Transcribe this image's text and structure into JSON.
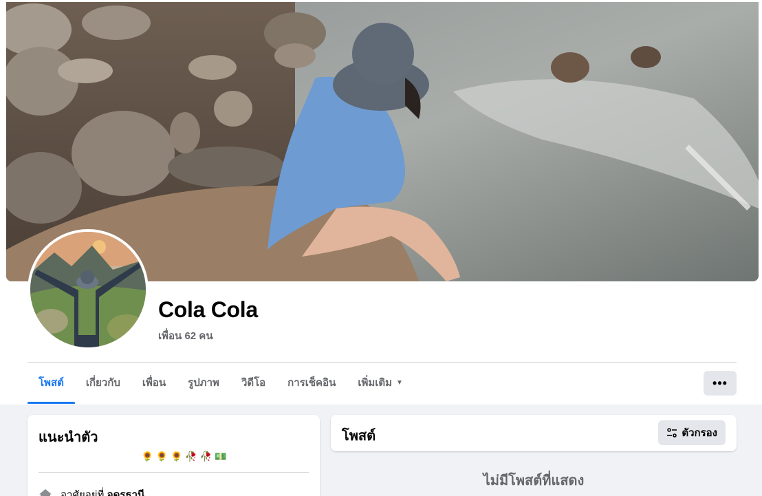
{
  "profile": {
    "name": "Cola Cola",
    "friends_text": "เพื่อน 62 คน"
  },
  "tabs": [
    {
      "label": "โพสต์",
      "active": true
    },
    {
      "label": "เกี่ยวกับ"
    },
    {
      "label": "เพื่อน"
    },
    {
      "label": "รูปภาพ"
    },
    {
      "label": "วิดีโอ"
    },
    {
      "label": "การเช็คอิน"
    },
    {
      "label": "เพิ่มเติม",
      "has_caret": true
    }
  ],
  "more_button": {
    "label": "•••",
    "icon": "ellipsis-icon"
  },
  "intro": {
    "title": "แนะนำตัว",
    "bio": "🌻 🌻 🌻 🥀 🥀 💵",
    "lives_in_label": "อาศัยอยู่ที่",
    "lives_in_value": "อุดรธานี",
    "lives_in_icon": "home-icon"
  },
  "posts": {
    "title": "โพสต์",
    "filter_label": "ตัวกรอง",
    "filter_icon": "filter-sliders-icon",
    "empty_text": "ไม่มีโพสต์ที่แสดง"
  },
  "colors": {
    "accent": "#1877f2",
    "page_bg": "#f0f2f5",
    "secondary_text": "#65676b",
    "button_bg": "#e4e6eb"
  }
}
